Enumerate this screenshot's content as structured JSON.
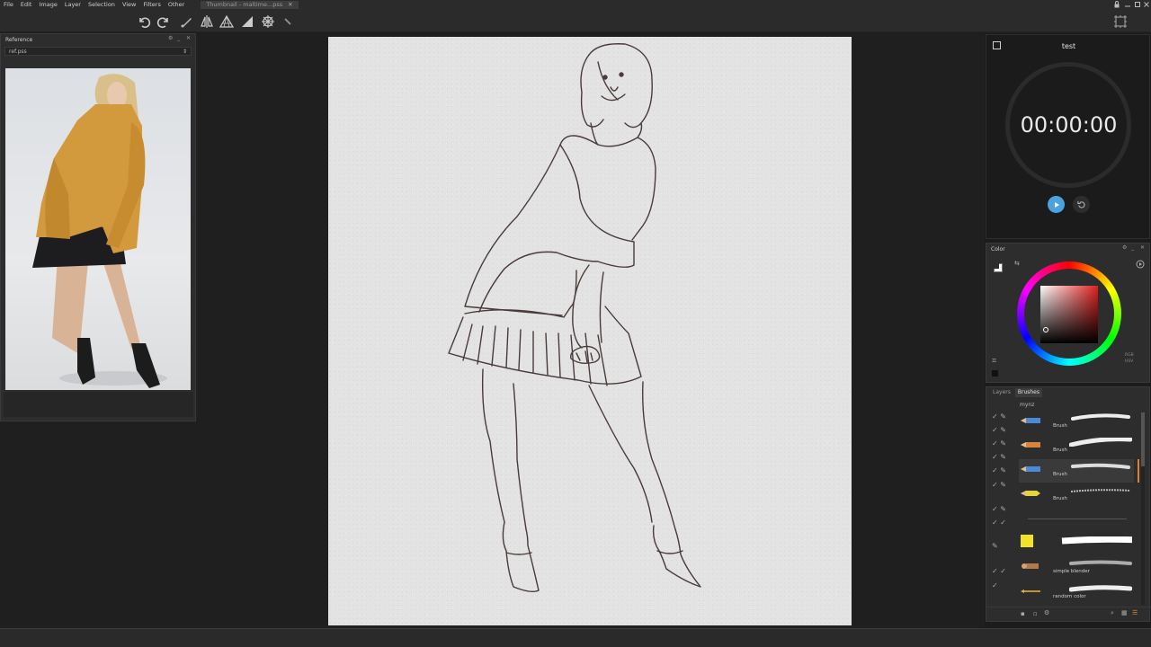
{
  "menu": [
    "File",
    "Edit",
    "Image",
    "Layer",
    "Selection",
    "View",
    "Filters",
    "Other"
  ],
  "document_tab": {
    "label": "Thumbnail - maltime...pss"
  },
  "toolbar": {
    "tools": [
      "undo-icon",
      "redo-icon",
      "brush-icon",
      "symmetry-icon",
      "perspective-icon",
      "ruler-icon",
      "radial-icon",
      "pen-icon"
    ]
  },
  "reference_panel": {
    "title": "Reference",
    "file": "ref.pss"
  },
  "timer": {
    "title": "test",
    "time": "00:00:00"
  },
  "color_panel": {
    "title": "Color",
    "hue_hex": "#e02020",
    "modes": [
      "RGB",
      "HSV"
    ]
  },
  "brush_panel": {
    "tabs": [
      "Layers",
      "Brushes"
    ],
    "active_tab": "Brushes",
    "set_name": "mynz",
    "brushes": [
      {
        "name": "Brush",
        "pencil": "blue",
        "selected": false
      },
      {
        "name": "Brush",
        "pencil": "orange",
        "selected": false
      },
      {
        "name": "Brush",
        "pencil": "blue",
        "selected": true
      },
      {
        "name": "Brush",
        "pencil": "yellow",
        "selected": false
      },
      {
        "name": "",
        "pencil": "marker",
        "selected": false
      },
      {
        "name": "simple blender",
        "pencil": "blender",
        "selected": false
      },
      {
        "name": "random color",
        "pencil": "paint",
        "selected": false
      }
    ]
  }
}
